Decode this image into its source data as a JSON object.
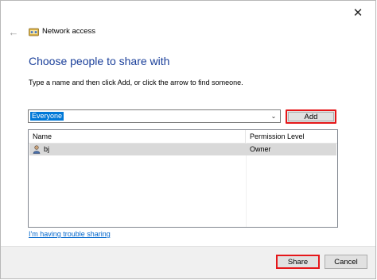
{
  "window": {
    "title": "Network access",
    "close_glyph": "✕",
    "back_glyph": "←"
  },
  "main": {
    "heading": "Choose people to share with",
    "instruction": "Type a name and then click Add, or click the arrow to find someone.",
    "combo": {
      "value": "Everyone",
      "arrow_glyph": "⌄"
    },
    "add_label": "Add",
    "table": {
      "columns": [
        "Name",
        "Permission Level"
      ],
      "rows": [
        {
          "name": "bj",
          "permission": "Owner"
        }
      ]
    },
    "help_link": "I'm having trouble sharing"
  },
  "footer": {
    "share_label": "Share",
    "cancel_label": "Cancel"
  },
  "colors": {
    "heading": "#1a3f9a",
    "highlight": "#e5171a",
    "selection": "#0078d7",
    "link": "#0066cc"
  },
  "icons": {
    "title": "network-share-icon",
    "user": "user-icon"
  }
}
